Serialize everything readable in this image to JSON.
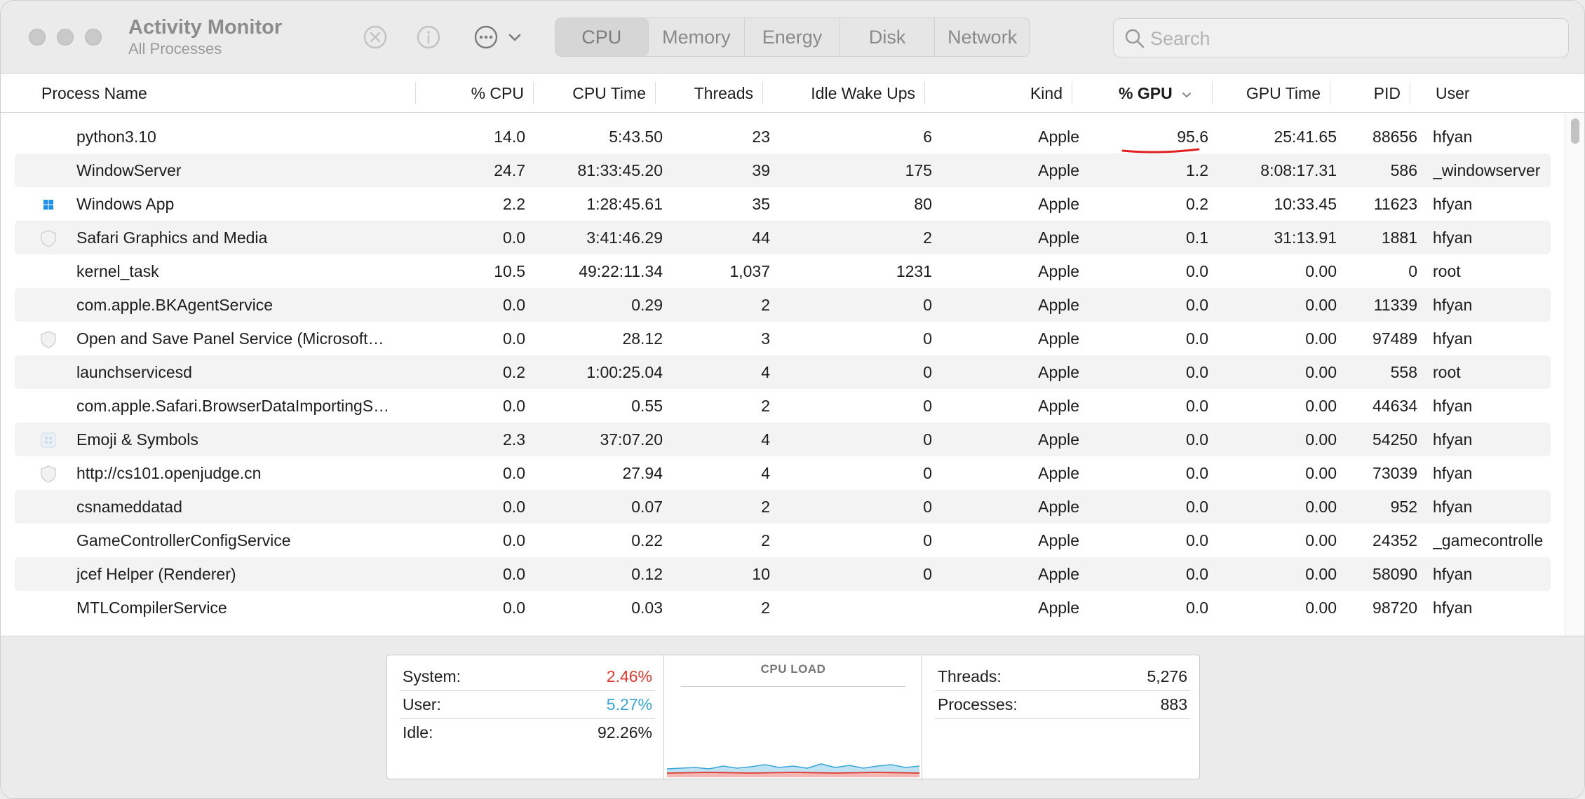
{
  "window": {
    "title": "Activity Monitor",
    "subtitle": "All Processes"
  },
  "toolbar": {
    "icons": [
      "stop-process-icon",
      "info-icon",
      "more-options-icon",
      "chevron-down-icon"
    ],
    "tabs": [
      {
        "label": "CPU",
        "active": true
      },
      {
        "label": "Memory",
        "active": false
      },
      {
        "label": "Energy",
        "active": false
      },
      {
        "label": "Disk",
        "active": false
      },
      {
        "label": "Network",
        "active": false
      }
    ],
    "search_placeholder": "Search"
  },
  "table": {
    "columns": [
      "Process Name",
      "% CPU",
      "CPU Time",
      "Threads",
      "Idle Wake Ups",
      "Kind",
      "% GPU",
      "GPU Time",
      "PID",
      "User"
    ],
    "sorted_column": "% GPU",
    "sort_direction": "descending",
    "rows": [
      {
        "icon": "none",
        "name": "python3.10",
        "cpu": "14.0",
        "cpu_time": "5:43.50",
        "threads": "23",
        "idle_wake_ups": "6",
        "kind": "Apple",
        "gpu": "95.6",
        "gpu_time": "25:41.65",
        "pid": "88656",
        "user": "hfyan"
      },
      {
        "icon": "none",
        "name": "WindowServer",
        "cpu": "24.7",
        "cpu_time": "81:33:45.20",
        "threads": "39",
        "idle_wake_ups": "175",
        "kind": "Apple",
        "gpu": "1.2",
        "gpu_time": "8:08:17.31",
        "pid": "586",
        "user": "_windowserver"
      },
      {
        "icon": "windows-app-icon",
        "name": "Windows App",
        "cpu": "2.2",
        "cpu_time": "1:28:45.61",
        "threads": "35",
        "idle_wake_ups": "80",
        "kind": "Apple",
        "gpu": "0.2",
        "gpu_time": "10:33.45",
        "pid": "11623",
        "user": "hfyan"
      },
      {
        "icon": "shield-icon",
        "name": "Safari Graphics and Media",
        "cpu": "0.0",
        "cpu_time": "3:41:46.29",
        "threads": "44",
        "idle_wake_ups": "2",
        "kind": "Apple",
        "gpu": "0.1",
        "gpu_time": "31:13.91",
        "pid": "1881",
        "user": "hfyan"
      },
      {
        "icon": "none",
        "name": "kernel_task",
        "cpu": "10.5",
        "cpu_time": "49:22:11.34",
        "threads": "1,037",
        "idle_wake_ups": "1231",
        "kind": "Apple",
        "gpu": "0.0",
        "gpu_time": "0.00",
        "pid": "0",
        "user": "root"
      },
      {
        "icon": "none",
        "name": "com.apple.BKAgentService",
        "cpu": "0.0",
        "cpu_time": "0.29",
        "threads": "2",
        "idle_wake_ups": "0",
        "kind": "Apple",
        "gpu": "0.0",
        "gpu_time": "0.00",
        "pid": "11339",
        "user": "hfyan"
      },
      {
        "icon": "shield-icon",
        "name": "Open and Save Panel Service (Microsoft…",
        "cpu": "0.0",
        "cpu_time": "28.12",
        "threads": "3",
        "idle_wake_ups": "0",
        "kind": "Apple",
        "gpu": "0.0",
        "gpu_time": "0.00",
        "pid": "97489",
        "user": "hfyan"
      },
      {
        "icon": "none",
        "name": "launchservicesd",
        "cpu": "0.2",
        "cpu_time": "1:00:25.04",
        "threads": "4",
        "idle_wake_ups": "0",
        "kind": "Apple",
        "gpu": "0.0",
        "gpu_time": "0.00",
        "pid": "558",
        "user": "root"
      },
      {
        "icon": "none",
        "name": "com.apple.Safari.BrowserDataImportingS…",
        "cpu": "0.0",
        "cpu_time": "0.55",
        "threads": "2",
        "idle_wake_ups": "0",
        "kind": "Apple",
        "gpu": "0.0",
        "gpu_time": "0.00",
        "pid": "44634",
        "user": "hfyan"
      },
      {
        "icon": "emoji-symbols-icon",
        "name": "Emoji & Symbols",
        "cpu": "2.3",
        "cpu_time": "37:07.20",
        "threads": "4",
        "idle_wake_ups": "0",
        "kind": "Apple",
        "gpu": "0.0",
        "gpu_time": "0.00",
        "pid": "54250",
        "user": "hfyan"
      },
      {
        "icon": "shield-icon",
        "name": "http://cs101.openjudge.cn",
        "cpu": "0.0",
        "cpu_time": "27.94",
        "threads": "4",
        "idle_wake_ups": "0",
        "kind": "Apple",
        "gpu": "0.0",
        "gpu_time": "0.00",
        "pid": "73039",
        "user": "hfyan"
      },
      {
        "icon": "none",
        "name": "csnameddatad",
        "cpu": "0.0",
        "cpu_time": "0.07",
        "threads": "2",
        "idle_wake_ups": "0",
        "kind": "Apple",
        "gpu": "0.0",
        "gpu_time": "0.00",
        "pid": "952",
        "user": "hfyan"
      },
      {
        "icon": "none",
        "name": "GameControllerConfigService",
        "cpu": "0.0",
        "cpu_time": "0.22",
        "threads": "2",
        "idle_wake_ups": "0",
        "kind": "Apple",
        "gpu": "0.0",
        "gpu_time": "0.00",
        "pid": "24352",
        "user": "_gamecontrolle"
      },
      {
        "icon": "none",
        "name": "jcef Helper (Renderer)",
        "cpu": "0.0",
        "cpu_time": "0.12",
        "threads": "10",
        "idle_wake_ups": "0",
        "kind": "Apple",
        "gpu": "0.0",
        "gpu_time": "0.00",
        "pid": "58090",
        "user": "hfyan"
      },
      {
        "icon": "none",
        "name": "MTLCompilerService",
        "cpu": "0.0",
        "cpu_time": "0.03",
        "threads": "2",
        "idle_wake_ups": "",
        "kind": "Apple",
        "gpu": "0.0",
        "gpu_time": "0.00",
        "pid": "98720",
        "user": "hfyan"
      }
    ]
  },
  "summary": {
    "left": [
      {
        "label": "System:",
        "value": "2.46%",
        "color": "#e03a30"
      },
      {
        "label": "User:",
        "value": "5.27%",
        "color": "#3aa6d8"
      },
      {
        "label": "Idle:",
        "value": "92.26%",
        "color": "#1d1d1f"
      }
    ],
    "cpu_load_title": "CPU LOAD",
    "right": [
      {
        "label": "Threads:",
        "value": "5,276"
      },
      {
        "label": "Processes:",
        "value": "883"
      }
    ]
  },
  "colors": {
    "system": "#e03a30",
    "user": "#3aa6d8",
    "annotation": "#e02020"
  }
}
